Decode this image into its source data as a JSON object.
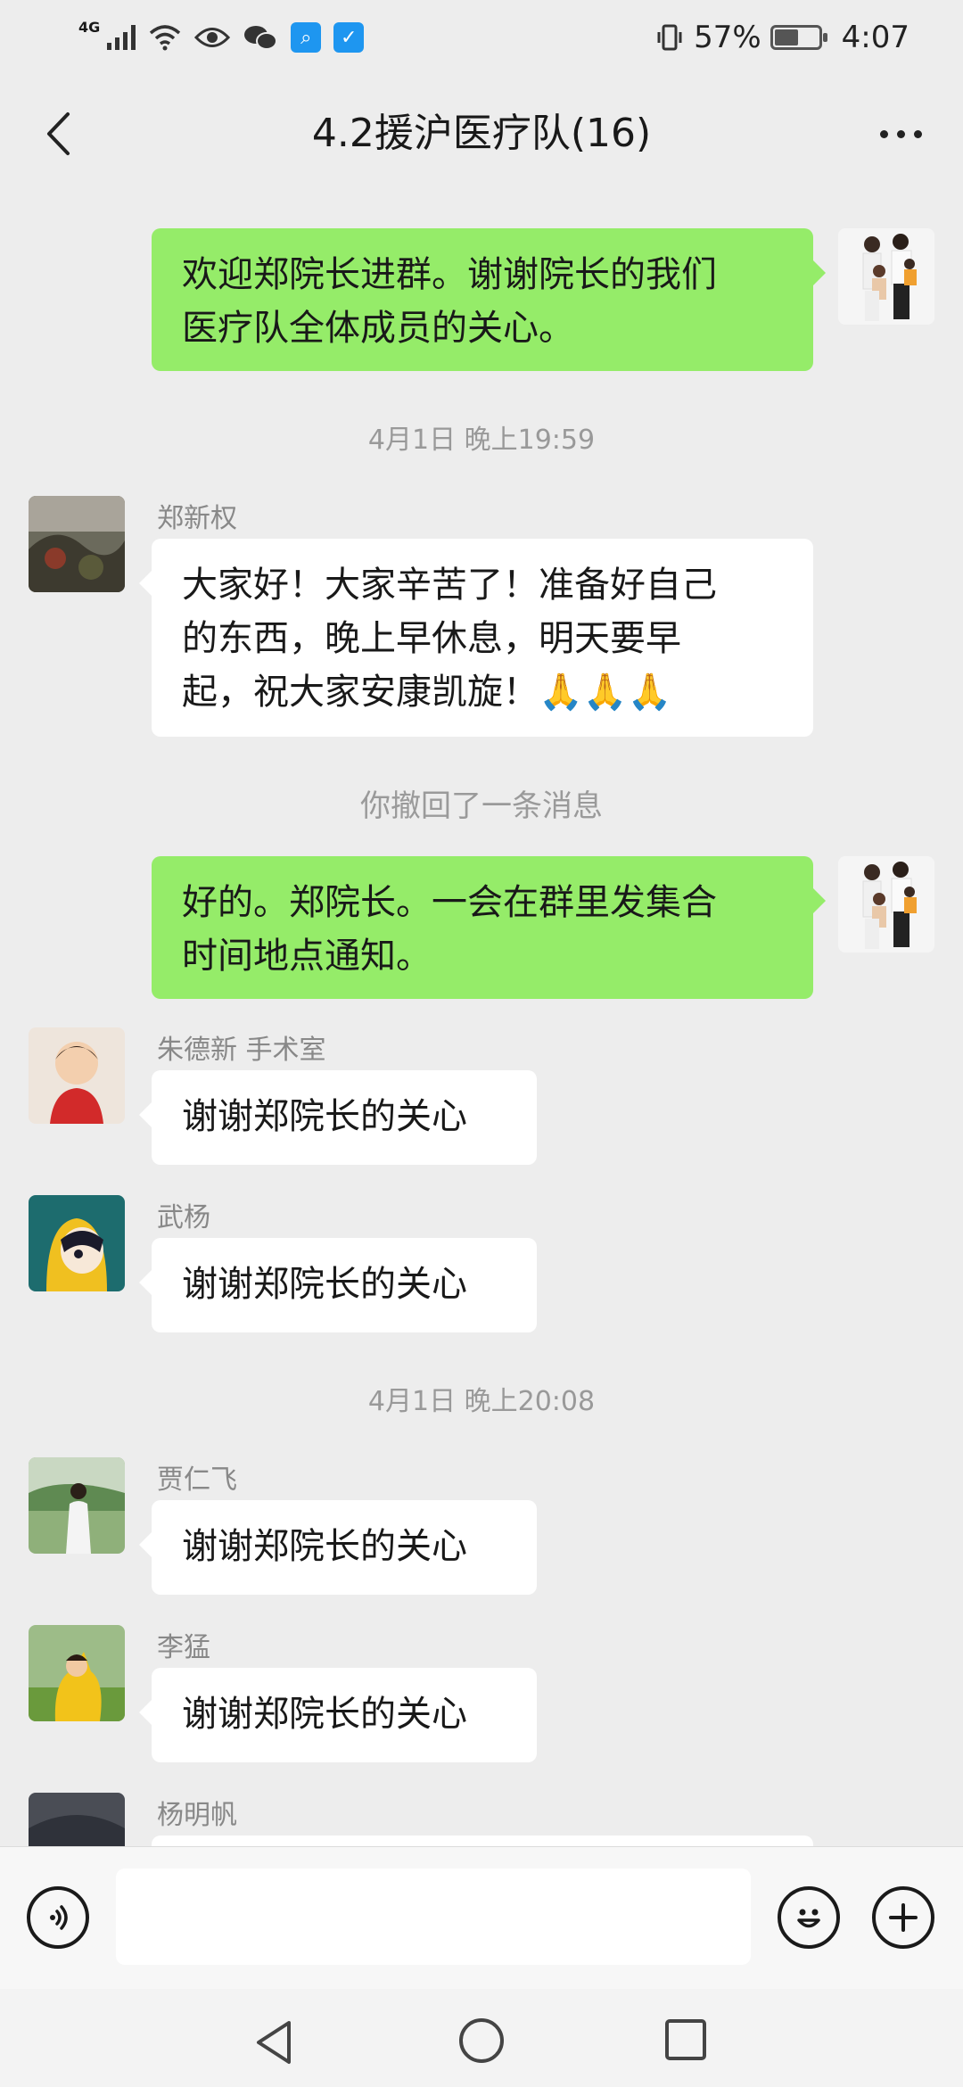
{
  "status_bar": {
    "network": "4G",
    "battery_percent": "57%",
    "battery_level": 0.57,
    "time": "4:07"
  },
  "header": {
    "title": "4.2援沪医疗队(16)"
  },
  "messages": [
    {
      "kind": "out",
      "lines": [
        "欢迎郑院长进群。谢谢院长的我们",
        "医疗队全体成员的关心。"
      ]
    },
    {
      "kind": "time",
      "text": "4月1日 晚上19:59"
    },
    {
      "kind": "in",
      "sender": "郑新权",
      "lines": [
        "大家好！大家辛苦了！准备好自己",
        "的东西，晚上早休息，明天要早",
        "起，祝大家安康凯旋！🙏🙏🙏"
      ]
    },
    {
      "kind": "system",
      "text": "你撤回了一条消息"
    },
    {
      "kind": "out",
      "lines": [
        "好的。郑院长。一会在群里发集合",
        "时间地点通知。"
      ]
    },
    {
      "kind": "in",
      "sender": "朱德新 手术室",
      "lines": [
        "谢谢郑院长的关心"
      ]
    },
    {
      "kind": "in",
      "sender": "武杨",
      "lines": [
        "谢谢郑院长的关心"
      ]
    },
    {
      "kind": "time",
      "text": "4月1日 晚上20:08"
    },
    {
      "kind": "in",
      "sender": "贾仁飞",
      "lines": [
        "谢谢郑院长的关心"
      ]
    },
    {
      "kind": "in",
      "sender": "李猛",
      "lines": [
        "谢谢郑院长的关心"
      ]
    },
    {
      "kind": "in",
      "sender": "杨明帆",
      "lines": [
        ""
      ]
    }
  ],
  "input": {
    "value": ""
  },
  "icons": {
    "back": "back-arrow-icon",
    "more": "more-dots-icon",
    "voice": "voice-icon",
    "emoji": "emoji-icon",
    "plus": "plus-icon"
  },
  "colors": {
    "background": "#ededed",
    "bubble_out": "#95ec69",
    "bubble_in": "#ffffff"
  }
}
